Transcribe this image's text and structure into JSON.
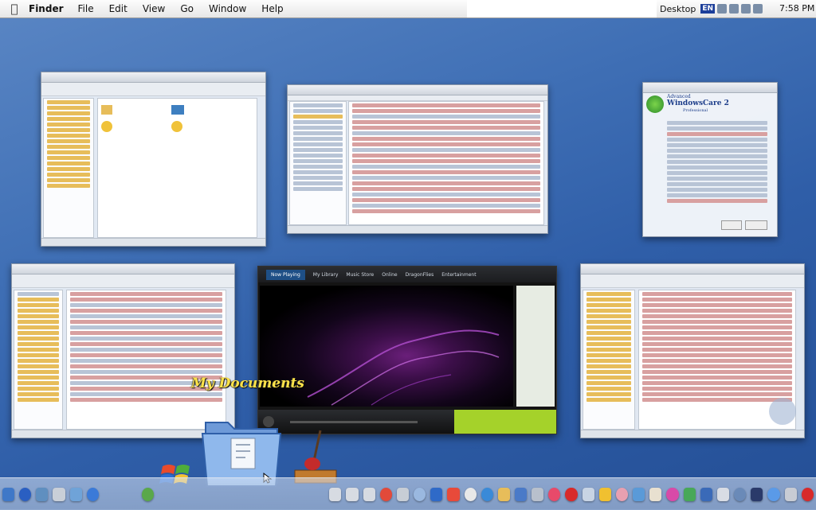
{
  "menubar": {
    "apple_icon": "apple-icon",
    "app_name": "Finder",
    "items": [
      "File",
      "Edit",
      "View",
      "Go",
      "Window",
      "Help"
    ],
    "desktop_label": "Desktop",
    "input_lang": "EN",
    "clock": "7:58 PM"
  },
  "windows": [
    {
      "name": "explorer-window-top-left",
      "type": "file-explorer"
    },
    {
      "name": "registry-editor-window",
      "type": "registry"
    },
    {
      "name": "windowscare-window",
      "type": "utility",
      "brand_line1": "Advanced",
      "brand_line2": "WindowsCare 2",
      "brand_line3": "Professional"
    },
    {
      "name": "explorer-window-bottom-left",
      "type": "file-explorer"
    },
    {
      "name": "explorer-window-bottom-right",
      "type": "file-explorer"
    }
  ],
  "media_player": {
    "tabs": [
      "Now Playing",
      "My Library",
      "Music Store",
      "Online",
      "DragonFlies",
      "Entertainment"
    ]
  },
  "highlight_label": "My Documents",
  "dock": {
    "icons": [
      "monitor-icon",
      "help-icon",
      "network-icon",
      "fax-icon",
      "tools-icon",
      "search-icon",
      "media-icon",
      "refresh-icon",
      "windows-logo-icon",
      "folder-icon",
      "cursor-icon",
      "guitar-icon",
      "dock-separator",
      "disk-icon",
      "disk-icon",
      "disk-icon",
      "chrome-icon",
      "printer-icon",
      "cd-icon",
      "outlook-icon",
      "exclamation-icon",
      "clock-icon",
      "globe-icon",
      "folder-icon",
      "book-icon",
      "ruler-icon",
      "music-icon",
      "stop-icon",
      "rocket-icon",
      "warning-icon",
      "pig-icon",
      "pictures-icon",
      "paint-icon",
      "cd-icon",
      "cards-icon",
      "network-icon",
      "mail-icon",
      "compass-icon",
      "frame-icon",
      "search-icon",
      "trash-icon",
      "power-icon"
    ]
  },
  "colors": {
    "desktop": "#3f6fb5",
    "label": "#ffe34a",
    "player_accent": "#a5d22a"
  }
}
